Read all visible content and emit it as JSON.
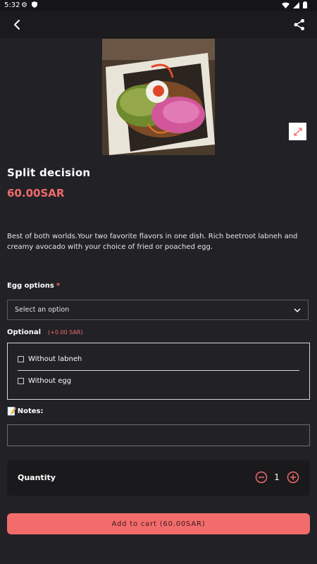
{
  "status_bar": {
    "time": "5:32"
  },
  "product": {
    "title": "Split decision",
    "price": "60.00SAR",
    "description": "Best of both worlds.Your two favorite flavors in one dish. Rich beetroot labneh and creamy avocado with your choice of fried or poached egg."
  },
  "egg_options": {
    "label": "Egg options",
    "required_mark": "*",
    "placeholder": "Select an option"
  },
  "optional": {
    "label": "Optional",
    "extra_price": "(+0.00 SAR)",
    "items": [
      {
        "label": "Without labneh",
        "checked": false
      },
      {
        "label": "Without egg",
        "checked": false
      }
    ]
  },
  "notes": {
    "label": "Notes:",
    "icon": "memo-icon",
    "value": ""
  },
  "quantity": {
    "label": "Quantity",
    "value": "1"
  },
  "cart_button": {
    "label": "Add to cart (60.00SAR)"
  },
  "colors": {
    "background": "#222226",
    "accent": "#f06a6a",
    "button": "#f26c6c",
    "card": "#1a1a1d"
  }
}
